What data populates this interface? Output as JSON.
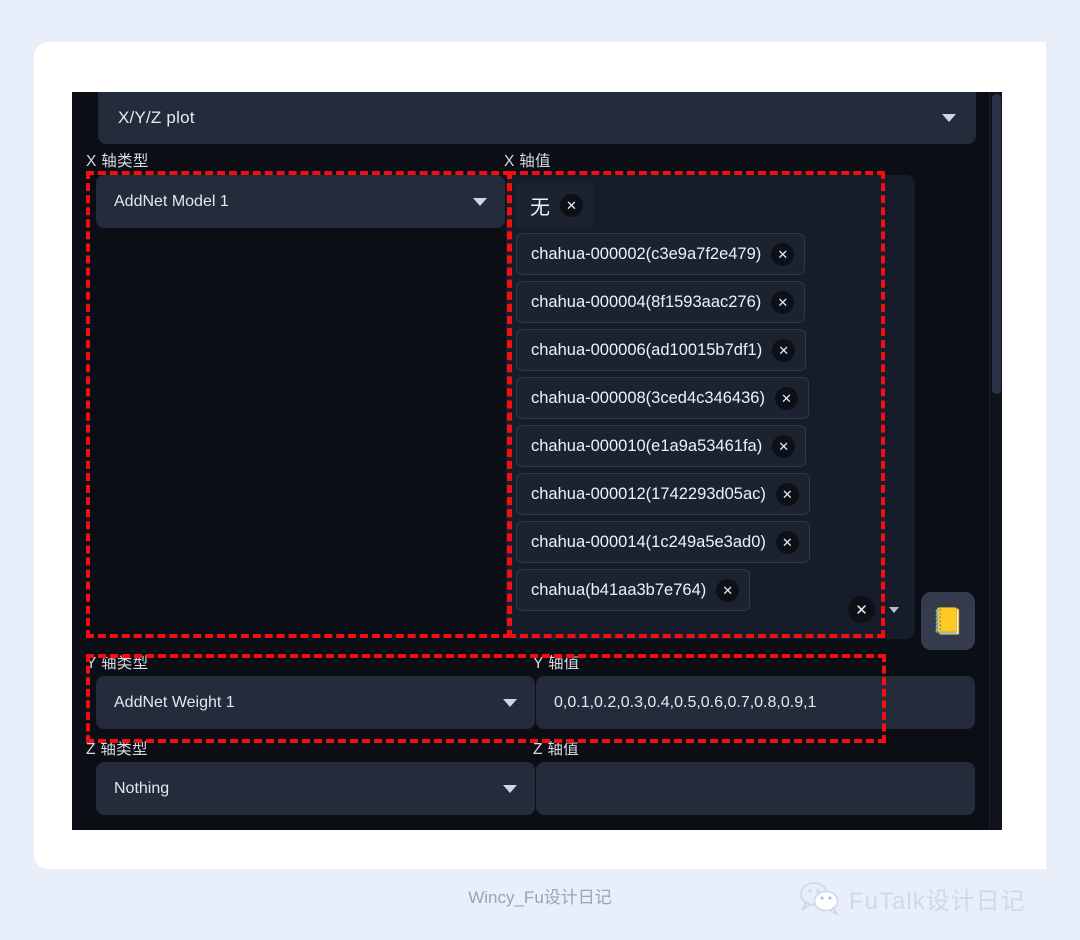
{
  "panel": {
    "plot_mode": {
      "label": "X/Y/Z plot",
      "caret_icon": "chevron-down-icon"
    },
    "x_axis": {
      "type_label": "X 轴类型",
      "type_value": "AddNet Model 1",
      "values_label": "X 轴值",
      "tags": [
        {
          "text": "无",
          "remove_icon": "close-icon",
          "plain": true
        },
        {
          "text": "chahua-000002(c3e9a7f2e479)",
          "remove_icon": "close-icon"
        },
        {
          "text": "chahua-000004(8f1593aac276)",
          "remove_icon": "close-icon"
        },
        {
          "text": "chahua-000006(ad10015b7df1)",
          "remove_icon": "close-icon"
        },
        {
          "text": "chahua-000008(3ced4c346436)",
          "remove_icon": "close-icon"
        },
        {
          "text": "chahua-000010(e1a9a53461fa)",
          "remove_icon": "close-icon"
        },
        {
          "text": "chahua-000012(1742293d05ac)",
          "remove_icon": "close-icon"
        },
        {
          "text": "chahua-000014(1c249a5e3ad0)",
          "remove_icon": "close-icon"
        },
        {
          "text": "chahua(b41aa3b7e764)",
          "remove_icon": "close-icon"
        }
      ],
      "clear_all_icon": "close-circle-icon",
      "caret_icon": "chevron-down-icon"
    },
    "y_axis": {
      "type_label": "Y 轴类型",
      "type_value": "AddNet Weight 1",
      "values_label": "Y 轴值",
      "values_value": "0,0.1,0.2,0.3,0.4,0.5,0.6,0.7,0.8,0.9,1"
    },
    "z_axis": {
      "type_label": "Z 轴类型",
      "type_value": "Nothing",
      "values_label": "Z 轴值",
      "values_value": ""
    },
    "notebook_button": {
      "icon": "notebook-icon",
      "glyph": "📒"
    },
    "scrollbar": {
      "name": "vertical-scrollbar"
    }
  },
  "annotations": {
    "accent_color": "#f40d12",
    "boxes": [
      {
        "name": "x-axis-type-highlight"
      },
      {
        "name": "x-axis-values-highlight"
      },
      {
        "name": "y-axis-row-highlight"
      }
    ]
  },
  "footer": {
    "caption": "Wincy_Fu设计日记",
    "brand_label": "FuTalk设计日记",
    "brand_icon": "wechat-icon"
  },
  "colors": {
    "page_background": "#e9eefb",
    "card_background": "#ffffff",
    "panel_background": "#0c0e15",
    "field_background": "#242b3a",
    "tag_background": "#1c2330",
    "annotation_red": "#f40d12"
  }
}
